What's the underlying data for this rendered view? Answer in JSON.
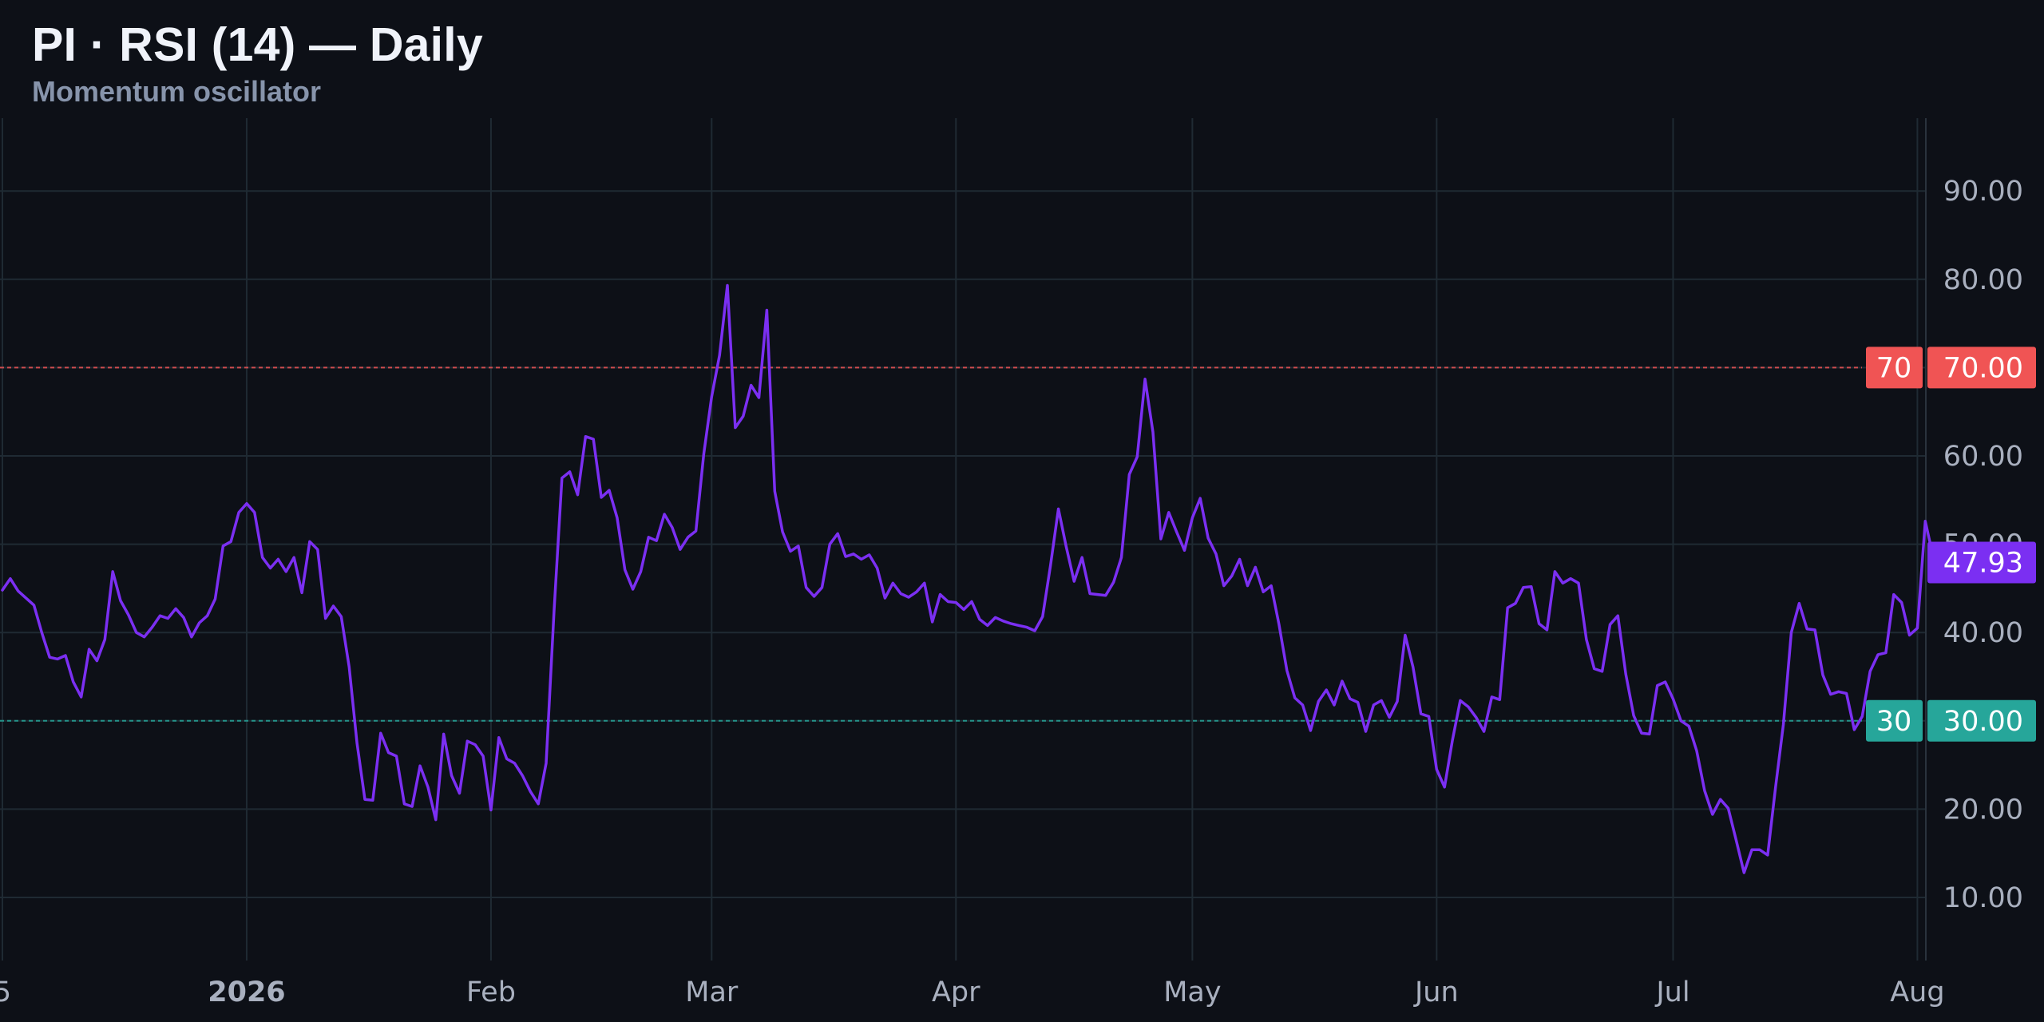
{
  "title": "PI · RSI (14) — Daily",
  "subtitle": "Momentum oscillator",
  "colors": {
    "background": "#0d1017",
    "grid": "#1f2a33",
    "axis_text": "#a9b0bf",
    "rsi_line": "#7b2ff2",
    "overbought": "#f05454",
    "oversold": "#26a69a",
    "label_text": "#ffffff"
  },
  "chart_data": {
    "type": "line",
    "series": [
      {
        "name": "RSI (14)",
        "start_date": "2025-12-01",
        "values": [
          44.8,
          46.1,
          44.7,
          43.9,
          43.1,
          40.0,
          37.2,
          37.0,
          37.4,
          34.4,
          32.7,
          38.1,
          36.8,
          39.2,
          46.9,
          43.6,
          42.0,
          40.0,
          39.5,
          40.6,
          41.9,
          41.6,
          42.7,
          41.7,
          39.5,
          41.1,
          41.9,
          43.8,
          49.8,
          50.3,
          53.6,
          54.6,
          53.6,
          48.5,
          47.3,
          48.3,
          46.9,
          48.5,
          44.5,
          50.3,
          49.4,
          41.6,
          43.0,
          41.8,
          36.1,
          27.5,
          21.1,
          21.0,
          28.6,
          26.4,
          26.0,
          20.6,
          20.3,
          24.9,
          22.5,
          18.8,
          28.5,
          23.8,
          21.8,
          27.7,
          27.3,
          26.0,
          19.9,
          28.1,
          25.7,
          25.2,
          23.8,
          22.0,
          20.6,
          25.2,
          42.4,
          57.5,
          58.2,
          55.6,
          62.2,
          61.9,
          55.3,
          56.1,
          53.0,
          47.1,
          44.9,
          46.9,
          50.8,
          50.4,
          53.4,
          51.9,
          49.4,
          50.8,
          51.5,
          60.2,
          66.7,
          71.4,
          79.3,
          63.2,
          64.5,
          68.0,
          66.6,
          76.5,
          56.0,
          51.4,
          49.2,
          49.8,
          45.1,
          44.1,
          45.1,
          50.0,
          51.2,
          48.6,
          48.9,
          48.3,
          48.8,
          47.3,
          43.9,
          45.6,
          44.4,
          44.0,
          44.6,
          45.6,
          41.2,
          44.3,
          43.5,
          43.4,
          42.6,
          43.5,
          41.5,
          40.8,
          41.7,
          41.3,
          41.0,
          40.8,
          40.6,
          40.2,
          41.8,
          47.6,
          54.0,
          49.7,
          45.8,
          48.5,
          44.4,
          44.3,
          44.2,
          45.7,
          48.5,
          57.9,
          59.9,
          68.7,
          62.7,
          50.6,
          53.6,
          51.4,
          49.3,
          53.0,
          55.2,
          50.7,
          48.9,
          45.3,
          46.4,
          48.3,
          45.3,
          47.4,
          44.6,
          45.3,
          40.9,
          35.7,
          32.6,
          31.8,
          28.9,
          32.2,
          33.5,
          31.8,
          34.5,
          32.5,
          32.1,
          28.8,
          31.8,
          32.3,
          30.4,
          32.2,
          39.7,
          36.1,
          30.8,
          30.5,
          24.5,
          22.5,
          27.8,
          32.3,
          31.6,
          30.4,
          28.8,
          32.7,
          32.4,
          42.8,
          43.3,
          45.1,
          45.2,
          41.0,
          40.3,
          46.9,
          45.6,
          46.1,
          45.6,
          39.2,
          35.9,
          35.6,
          40.9,
          41.9,
          35.3,
          30.6,
          28.6,
          28.5,
          34.0,
          34.4,
          32.5,
          30.0,
          29.4,
          26.6,
          22.1,
          19.4,
          21.1,
          20.1,
          16.5,
          12.8,
          15.4,
          15.4,
          14.8,
          22.5,
          29.6,
          40.0,
          43.3,
          40.4,
          40.3,
          35.2,
          33.0,
          33.3,
          33.1,
          29.0,
          30.5,
          35.6,
          37.5,
          37.7,
          44.3,
          43.4,
          39.7,
          40.5,
          52.6,
          48.6,
          47.9
        ]
      }
    ],
    "y_ticks": [
      "10.00",
      "20.00",
      "30.00",
      "40.00",
      "50.00",
      "60.00",
      "70.00",
      "80.00",
      "90.00"
    ],
    "x_ticks": [
      {
        "date": "2025-12-01",
        "label": "5"
      },
      {
        "date": "2026-01-01",
        "label": "2026"
      },
      {
        "date": "2026-02-01",
        "label": "Feb"
      },
      {
        "date": "2026-03-01",
        "label": "Mar"
      },
      {
        "date": "2026-04-01",
        "label": "Apr"
      },
      {
        "date": "2026-05-01",
        "label": "May"
      },
      {
        "date": "2026-06-01",
        "label": "Jun"
      },
      {
        "date": "2026-07-01",
        "label": "Jul"
      },
      {
        "date": "2026-08-01",
        "label": "Aug"
      }
    ],
    "ylim": [
      3,
      99
    ],
    "overbought": {
      "value": 70,
      "level_label": "70",
      "axis_label": "70.00"
    },
    "oversold": {
      "value": 30,
      "level_label": "30",
      "axis_label": "30.00"
    },
    "last_value_label": "47.93",
    "grid": true
  }
}
